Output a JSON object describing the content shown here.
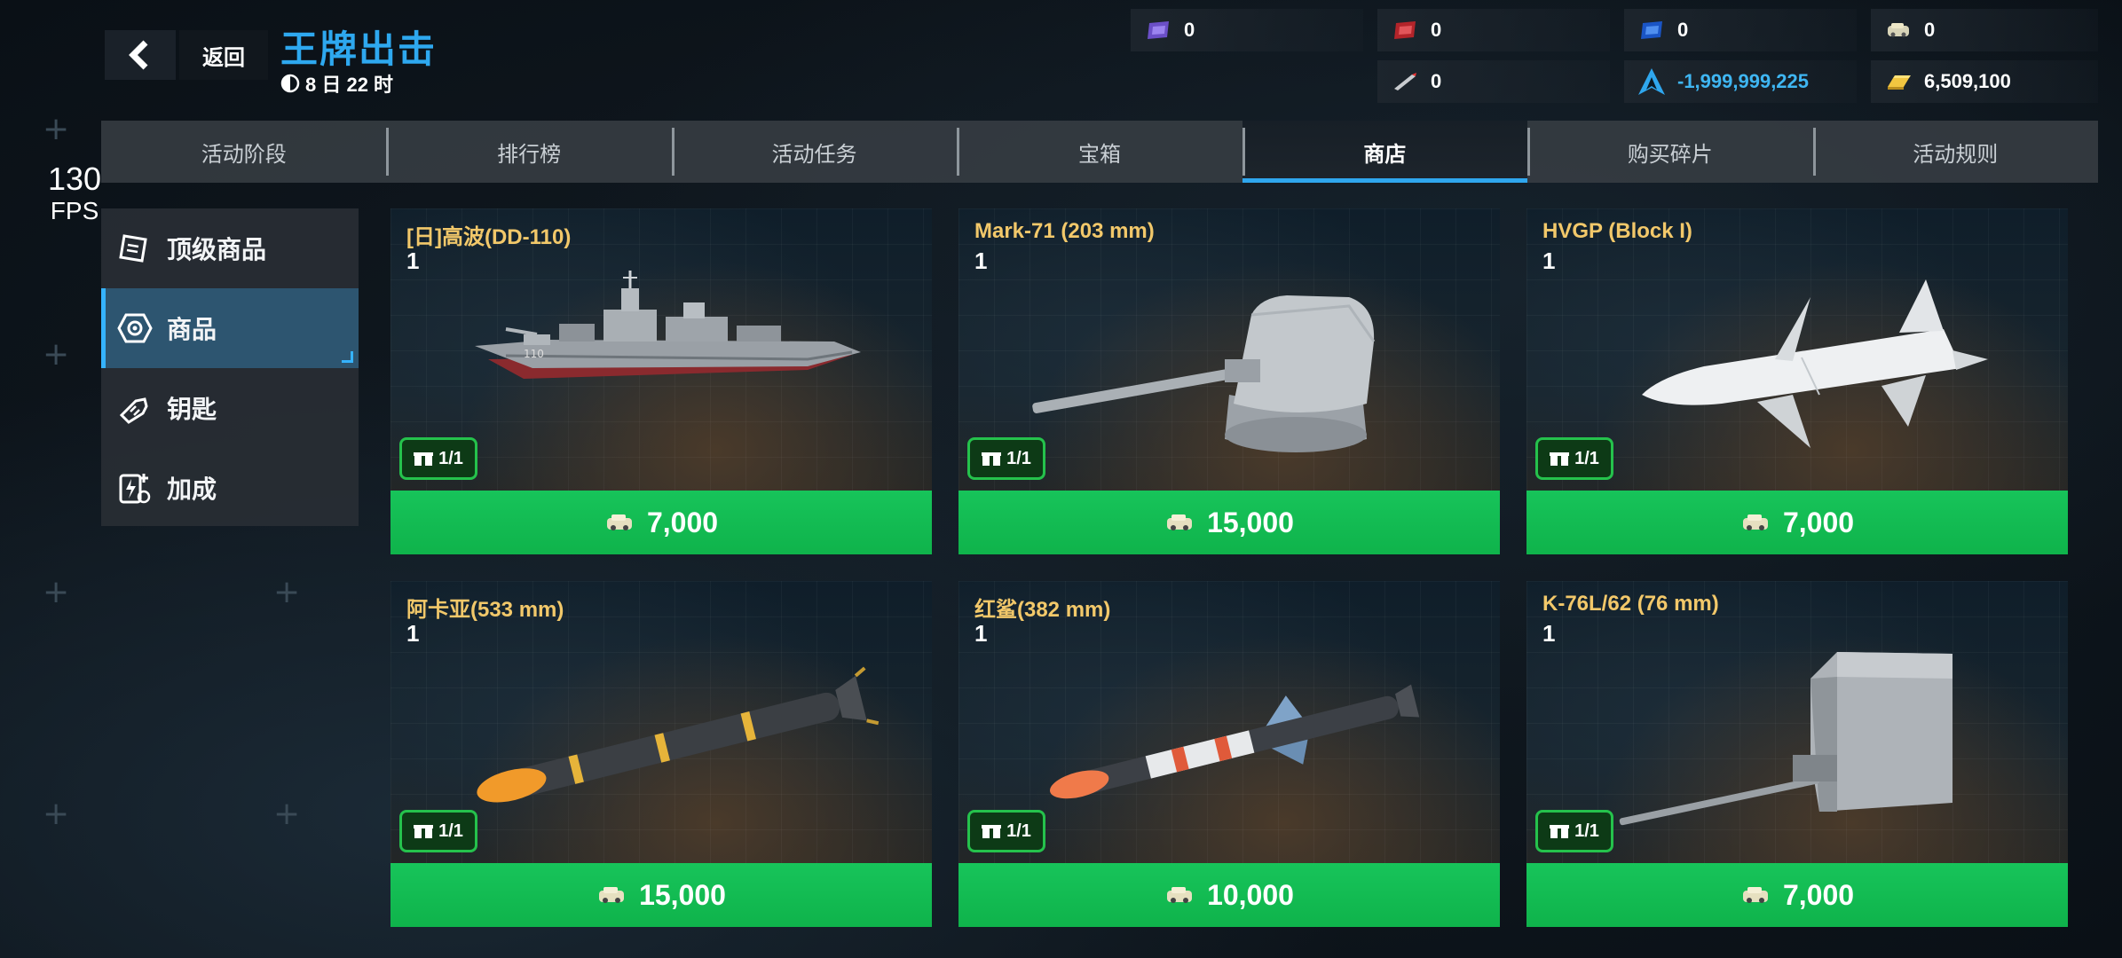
{
  "header": {
    "back_label": "返回",
    "event_title": "王牌出击",
    "event_timer": "8 日 22 时"
  },
  "resources": {
    "purple_ticket": "0",
    "red_ticket": "0",
    "blue_ticket": "0",
    "tank_token": "0",
    "missile_token": "0",
    "premium_currency": "-1,999,999,225",
    "gold": "6,509,100"
  },
  "fps": {
    "value": "130",
    "unit": "FPS"
  },
  "tabs": [
    {
      "label": "活动阶段"
    },
    {
      "label": "排行榜"
    },
    {
      "label": "活动任务"
    },
    {
      "label": "宝箱"
    },
    {
      "label": "商店",
      "active": true
    },
    {
      "label": "购买碎片"
    },
    {
      "label": "活动规则"
    }
  ],
  "side_menu": [
    {
      "label": "顶级商品",
      "icon": "ticket-icon"
    },
    {
      "label": "商品",
      "icon": "gear-badge-icon",
      "active": true
    },
    {
      "label": "钥匙",
      "icon": "key-icon"
    },
    {
      "label": "加成",
      "icon": "boost-icon"
    }
  ],
  "colors": {
    "accent": "#2fa7ee",
    "buy_green": "#17c45a",
    "item_name": "#f2c86a",
    "currency_negative": "#3fb6f2",
    "gold": "#f2c640"
  },
  "items": [
    {
      "name": "[日]高波(DD-110)",
      "qty": "1",
      "limit": "1/1",
      "price": "7,000",
      "art": "destroyer-ship"
    },
    {
      "name": "Mark-71 (203 mm)",
      "qty": "1",
      "limit": "1/1",
      "price": "15,000",
      "art": "naval-gun-turret"
    },
    {
      "name": "HVGP (Block I)",
      "qty": "1",
      "limit": "1/1",
      "price": "7,000",
      "art": "missile"
    },
    {
      "name": "阿卡亚(533 mm)",
      "qty": "1",
      "limit": "1/1",
      "price": "15,000",
      "art": "torpedo"
    },
    {
      "name": "红鲨(382 mm)",
      "qty": "1",
      "limit": "1/1",
      "price": "10,000",
      "art": "rocket-torpedo"
    },
    {
      "name": "K-76L/62 (76 mm)",
      "qty": "1",
      "limit": "1/1",
      "price": "7,000",
      "art": "naval-gun-turret-small"
    }
  ]
}
